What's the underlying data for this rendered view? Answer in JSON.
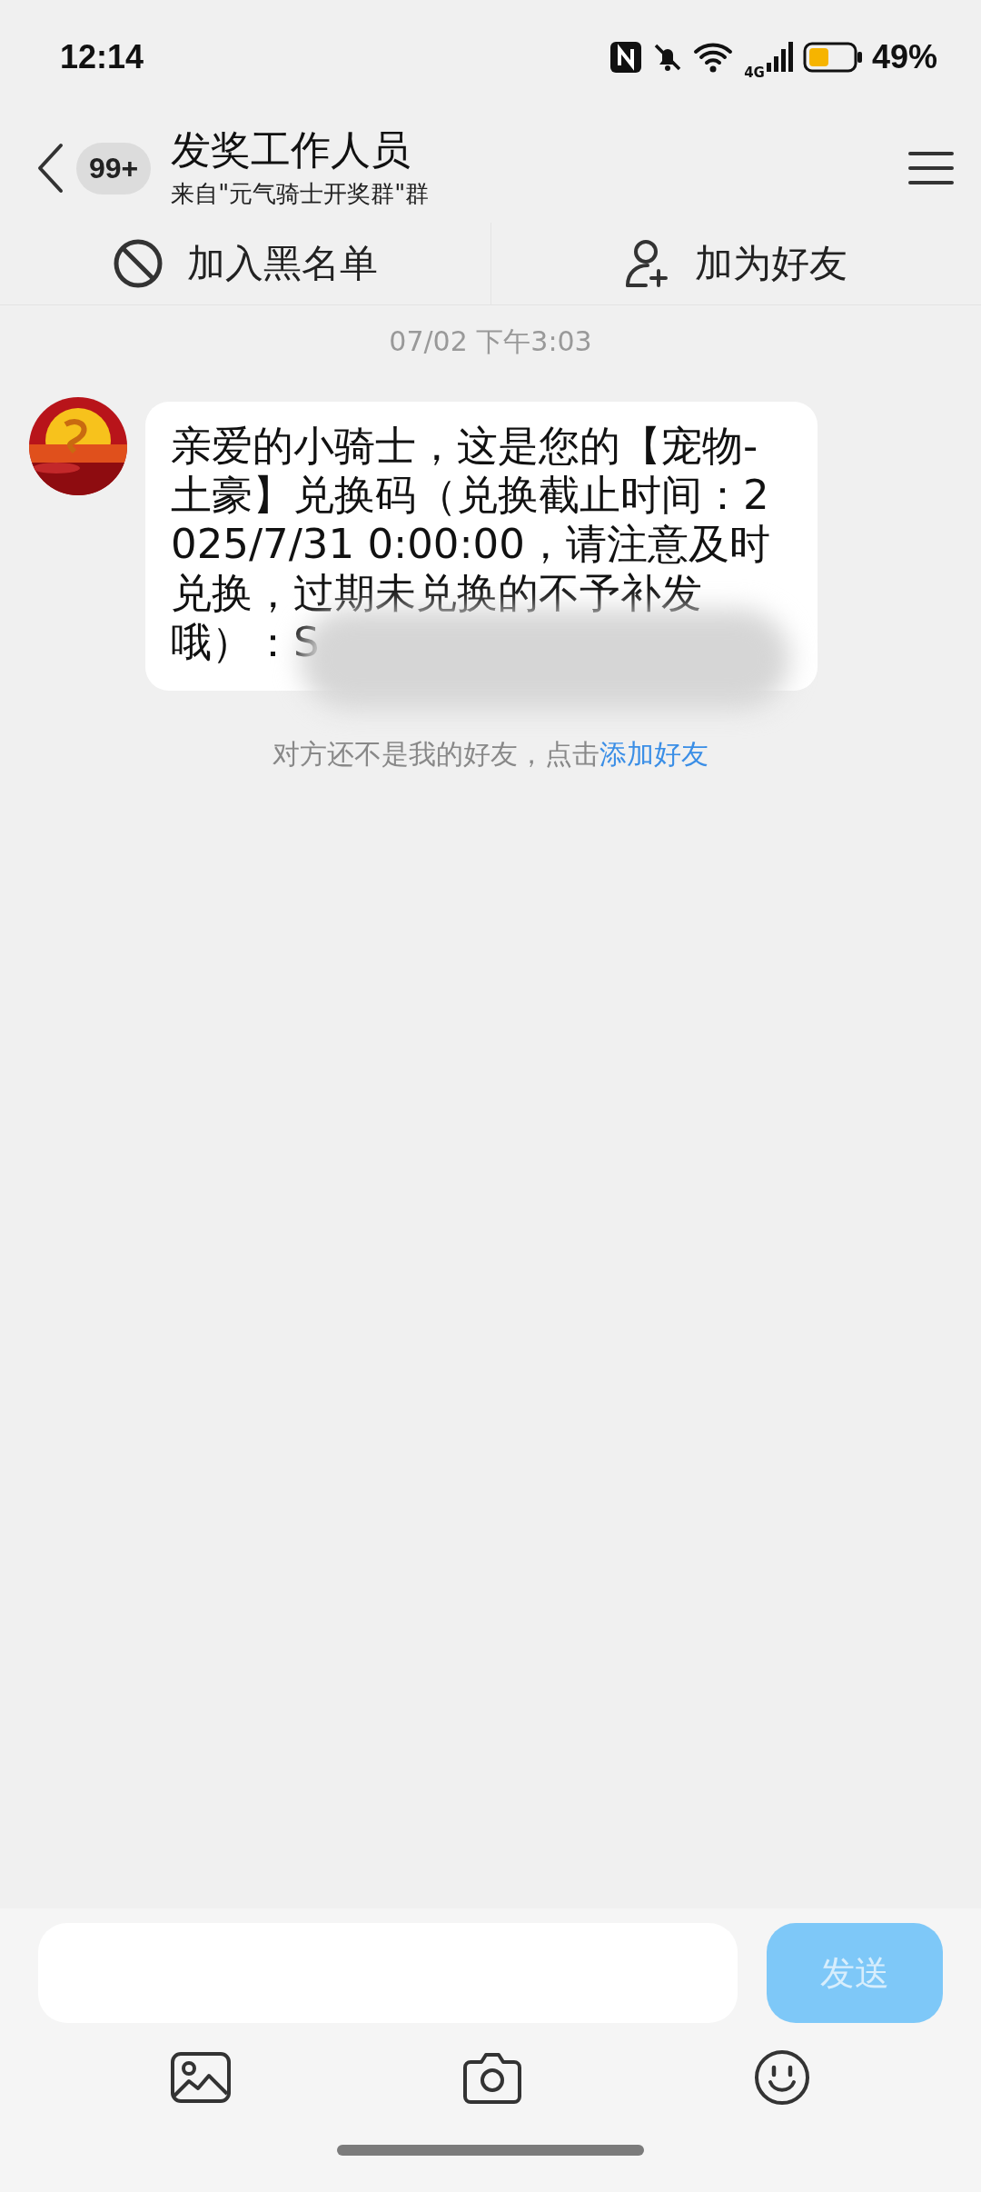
{
  "status_bar": {
    "time": "12:14",
    "network": "4G",
    "battery": "49%"
  },
  "header": {
    "unread_badge": "99+",
    "title": "发奖工作人员",
    "subtitle": "来自\"元气骑士开奖群\"群"
  },
  "actions": [
    {
      "label": "加入黑名单",
      "kind": "block"
    },
    {
      "label": "加为好友",
      "kind": "add-friend"
    }
  ],
  "timestamp": "07/02 下午3:03",
  "message": {
    "text": "亲爱的小骑士，这是您的【宠物-土豪】兑换码（兑换截止时间：2025/7/31 0:00:00，请注意及时兑换，过期未兑换的不予补发哦）：S",
    "redacted": true
  },
  "notice": {
    "text": "对方还不是我的好友，点击",
    "link": "添加好友"
  },
  "composer": {
    "send_label": "发送",
    "send_enabled": false
  }
}
